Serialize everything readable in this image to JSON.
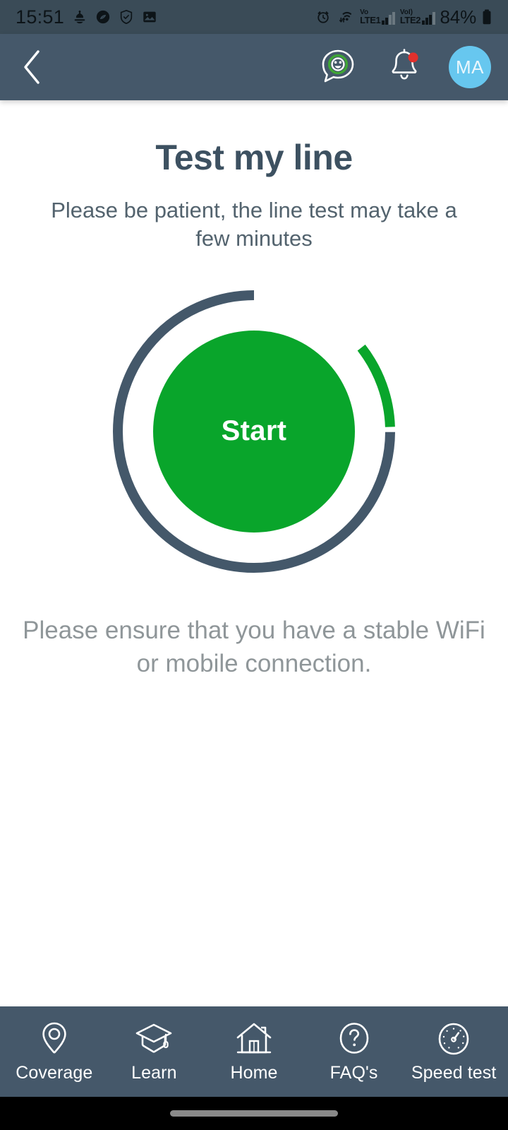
{
  "statusbar": {
    "time": "15:51",
    "battery": "84%",
    "left_icons": [
      "silent-mode-icon",
      "shazam-icon",
      "shield-check-icon",
      "image-icon"
    ],
    "right_icons": [
      "alarm-icon",
      "wifi-icon"
    ],
    "sim1_label_top": "Vo",
    "sim1_label_bottom": "LTE1",
    "sim2_label_top": "VoI)",
    "sim2_label_bottom": "LTE2"
  },
  "header": {
    "back_icon": "chevron-left-icon",
    "chat_icon": "chat-smiley-icon",
    "notification_icon": "bell-icon",
    "notification_badge": true,
    "avatar_initials": "MA"
  },
  "main": {
    "title": "Test my line",
    "subtitle": "Please be patient, the line test may take a few minutes",
    "start_label": "Start",
    "note": "Please ensure that you have a stable WiFi or mobile connection."
  },
  "gauge": {
    "progress_start_deg": 52,
    "progress_end_deg": 88,
    "track_color": "#44586a",
    "progress_color": "#09a52b",
    "button_color": "#09a52b"
  },
  "bottomnav": {
    "items": [
      {
        "label": "Coverage",
        "icon": "map-pin-icon"
      },
      {
        "label": "Learn",
        "icon": "graduation-cap-icon"
      },
      {
        "label": "Home",
        "icon": "house-icon"
      },
      {
        "label": "FAQ's",
        "icon": "question-circle-icon"
      },
      {
        "label": "Speed test",
        "icon": "speedometer-icon"
      }
    ]
  },
  "colors": {
    "header_bg": "#45586a",
    "statusbar_bg": "#3a4b57",
    "accent_green": "#09a52b",
    "slate": "#44586a",
    "avatar_blue": "#67c7ef",
    "badge_red": "#e2302c"
  }
}
